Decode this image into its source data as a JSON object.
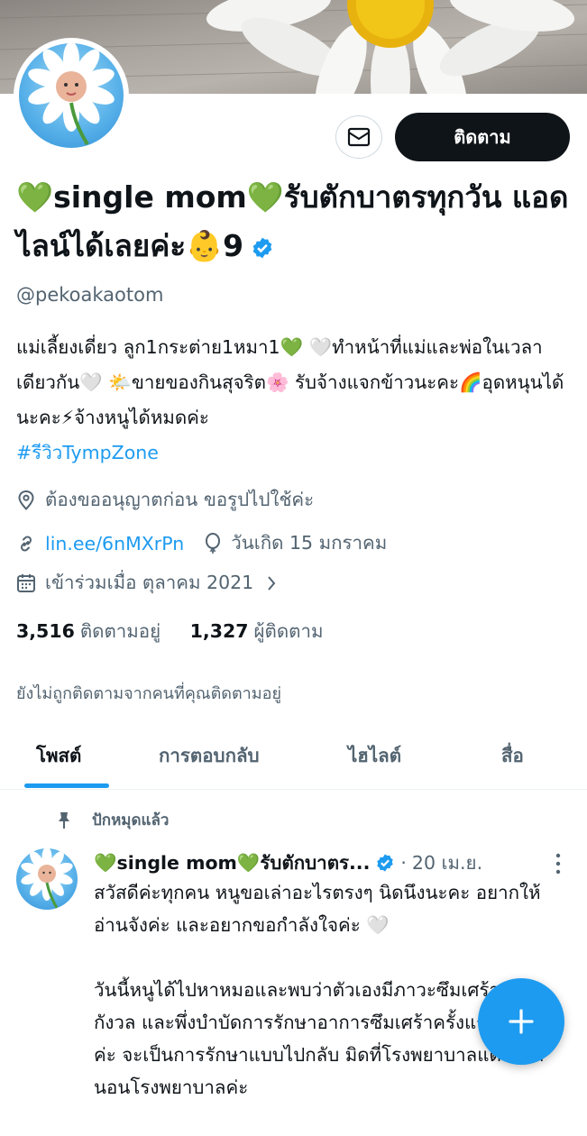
{
  "profile": {
    "display_name": "💚single mom💚รับตักบาตรทุกวัน แอดไลน์ได้เลยค่ะ👶9",
    "handle": "@pekoakaotom",
    "bio_text": "แม่เลี้ยงเดี่ยว ลูก1กระต่าย1หมา1💚 🤍ทำหน้าที่แม่และพ่อในเวลาเดียวกัน🤍 🌤️ขายของกินสุจริต🌸 รับจ้างแจกข้าวนะคะ🌈อุดหนุนได้นะคะ⚡จ้างหนูได้หมดค่ะ",
    "bio_hashtag": "#รีวิวTympZone",
    "location": "ต้องขออนุญาตก่อน ขอรูปไปใช้ค่ะ",
    "link": "lin.ee/6nMXrPn",
    "birthday": "วันเกิด 15 มกราคม",
    "joined": "เข้าร่วมเมื่อ ตุลาคม 2021",
    "following_count": "3,516",
    "following_label": "ติดตามอยู่",
    "followers_count": "1,327",
    "followers_label": "ผู้ติดตาม",
    "not_followed_note": "ยังไม่ถูกติดตามจากคนที่คุณติดตามอยู่"
  },
  "actions": {
    "follow_label": "ติดตาม",
    "message_icon": "envelope-icon"
  },
  "tabs": [
    {
      "label": "โพสต์",
      "active": true
    },
    {
      "label": "การตอบกลับ",
      "active": false
    },
    {
      "label": "ไฮไลต์",
      "active": false
    },
    {
      "label": "สื่อ",
      "active": false
    }
  ],
  "pinned_post": {
    "pinned_label": "ปักหมุดแล้ว",
    "author": "💚single mom💚รับตักบาตร...",
    "dot": "·",
    "time": "20 เม.ย.",
    "paragraph_1": "สวัสดีค่ะทุกคน หนูขอเล่าอะไรตรงๆ นิดนึงนะคะ อยากให้อ่านจังค่ะ และอยากขอกำลังใจค่ะ 🤍",
    "paragraph_2": "วันนี้หนูได้ไปหาหมอและพบว่าตัวเองมีภาวะซึมเศร้า วิตกกังวล และพึ่งบำบัดการรักษาอาการซึมเศร้าครั้งแรกในชีวิตค่ะ จะเป็นการรักษาแบบไปกลับ มิดที่โรงพยาบาลแต่ไม่ได้นอนโรงพยาบาลค่ะ"
  },
  "colors": {
    "accent": "#1d9bf0",
    "text_primary": "#0f1419",
    "text_secondary": "#536471",
    "follow_button_bg": "#0f1419"
  }
}
